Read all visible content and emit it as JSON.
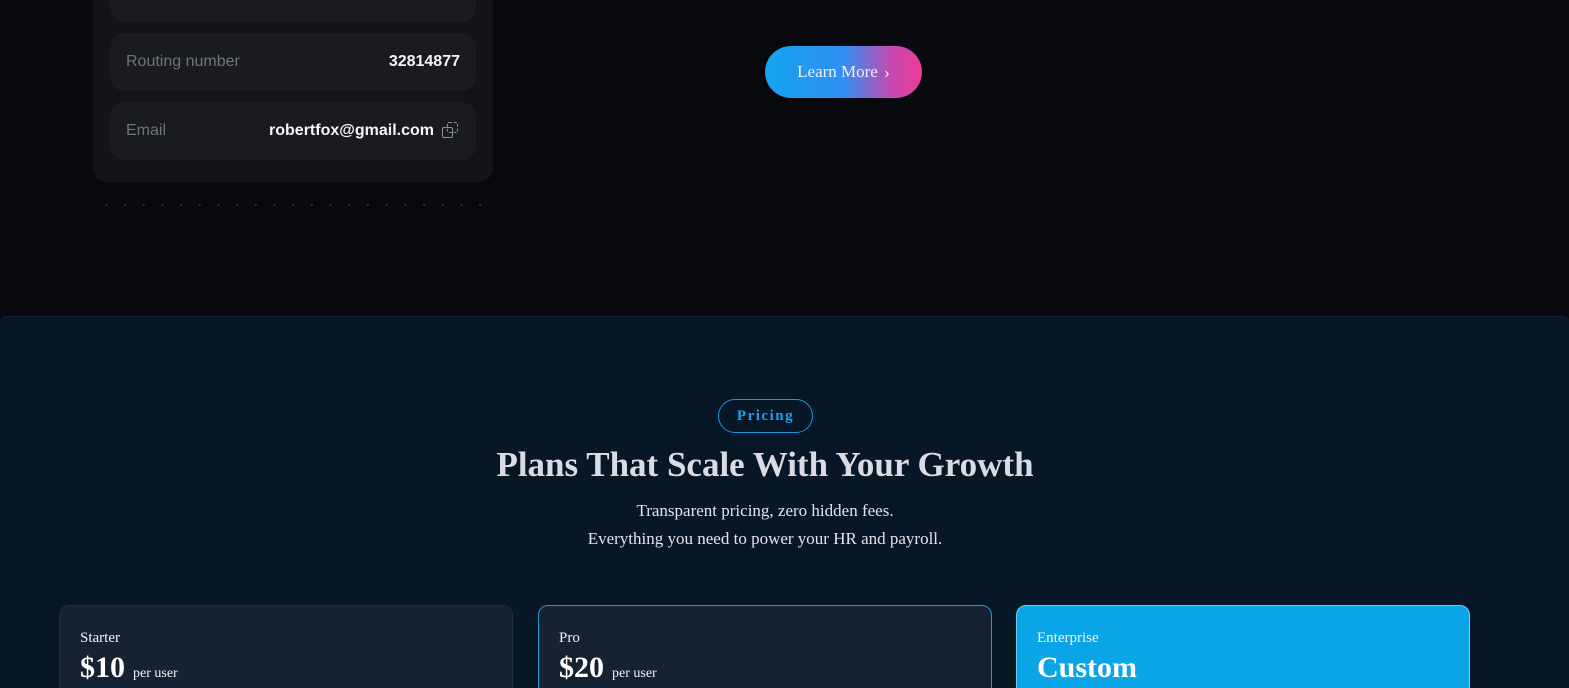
{
  "bank_card": {
    "routing_label": "Routing number",
    "routing_value": "32814877",
    "email_label": "Email",
    "email_value": "robertfox@gmail.com"
  },
  "cta": {
    "learn_more_label": "Learn More",
    "chevron_icon": "chevron-right-icon",
    "gradient_colors": [
      "#14a4ef",
      "#ee3b95"
    ]
  },
  "pricing": {
    "badge": "Pricing",
    "title": "Plans That Scale With Your Growth",
    "subtitle_line1": "Transparent pricing, zero hidden fees.",
    "subtitle_line2": "Everything you need to power your HR and payroll.",
    "plans": [
      {
        "name": "Starter",
        "price": "$10",
        "unit": "per user"
      },
      {
        "name": "Pro",
        "price": "$20",
        "unit": "per user"
      },
      {
        "name": "Enterprise",
        "price": "Custom",
        "unit": ""
      }
    ],
    "accent_color": "#0aa5e6"
  }
}
